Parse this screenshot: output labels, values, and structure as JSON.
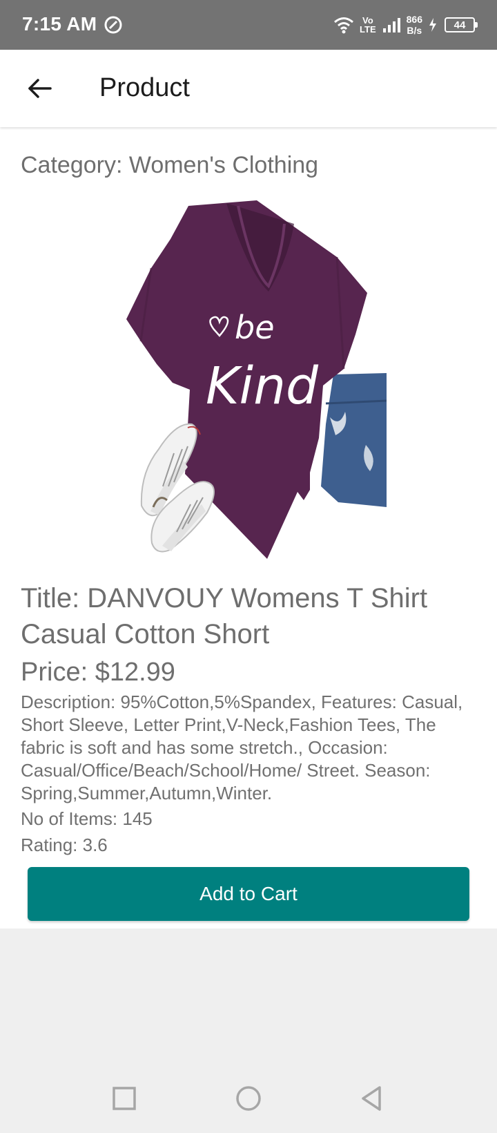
{
  "status_bar": {
    "time": "7:15 AM",
    "volte_top": "Vo",
    "volte_bottom": "LTE",
    "speed_value": "866",
    "speed_unit": "B/s",
    "battery": "44"
  },
  "app_bar": {
    "title": "Product",
    "back_icon": "arrow-left-icon"
  },
  "product": {
    "category": "Category: Women's Clothing",
    "image_print_text_line1": "be",
    "image_print_text_line2": "Kind",
    "title": "Title: DANVOUY Womens T Shirt Casual Cotton Short",
    "price": "Price: $12.99",
    "description": "Description: 95%Cotton,5%Spandex, Features: Casual, Short Sleeve, Letter Print,V-Neck,Fashion Tees, The fabric is soft and has some stretch., Occasion: Casual/Office/Beach/School/Home/ Street. Season: Spring,Summer,Autumn,Winter.",
    "items": "No of Items: 145",
    "rating": "Rating: 3.6",
    "add_to_cart": "Add to Cart"
  },
  "nav_bar": {
    "recents_icon": "square-icon",
    "home_icon": "circle-icon",
    "back_icon": "triangle-back-icon"
  },
  "colors": {
    "accent": "#00807f",
    "status_bar": "#737373",
    "shirt": "#57254f"
  }
}
